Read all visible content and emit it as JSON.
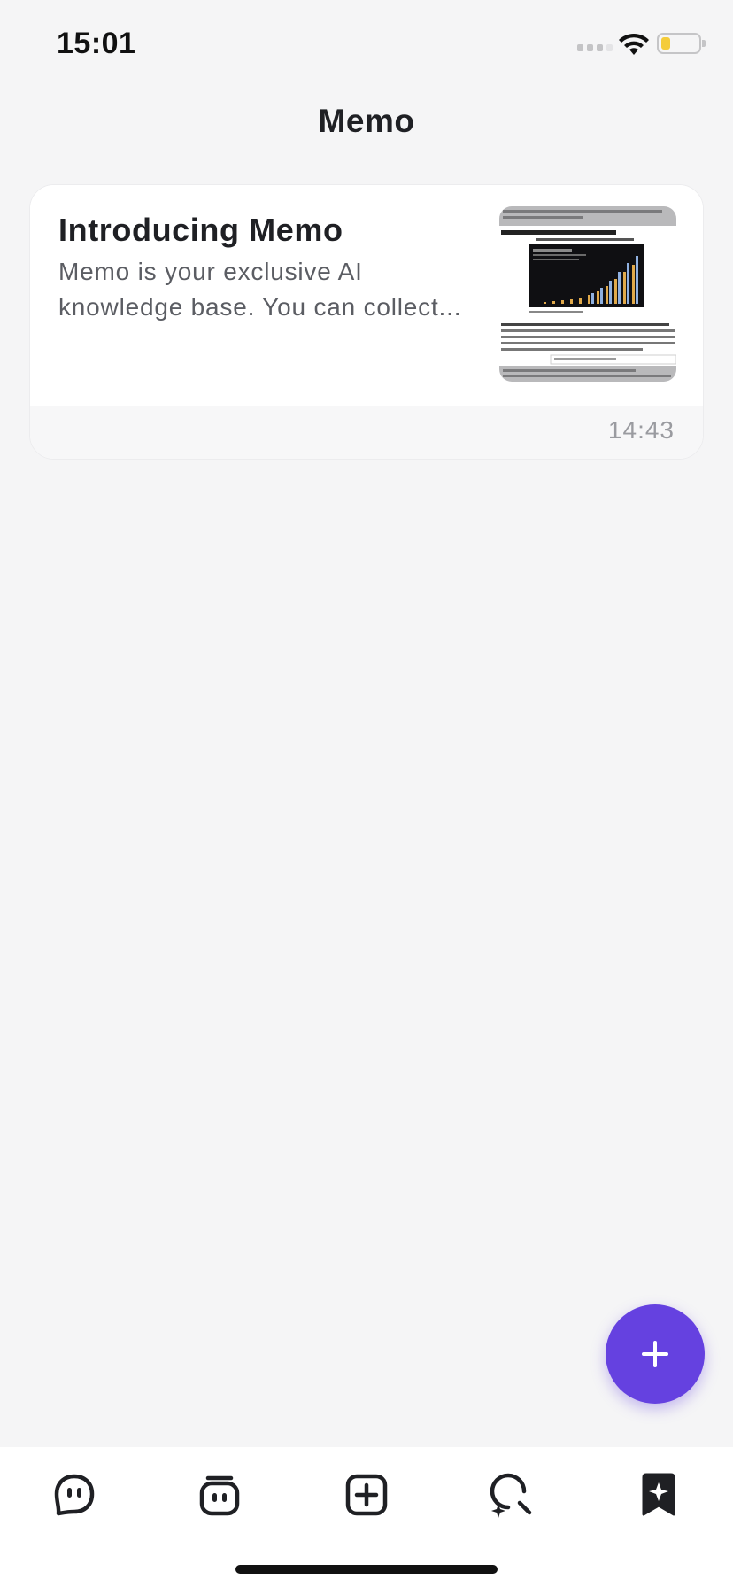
{
  "status_bar": {
    "time": "15:01",
    "icons": [
      "signal-icon",
      "wifi-icon",
      "battery-icon"
    ],
    "battery_color": "#f4cc3a"
  },
  "header": {
    "title": "Memo"
  },
  "memos": [
    {
      "title": "Introducing Memo",
      "snippet": "Memo is your exclusive AI knowledge base. You can collect...",
      "time": "14:43",
      "thumbnail": {
        "heading": "Generative AI Life Sciences, Education Spending",
        "chart_subtitle": "Generative AI Life Sciences, Education Spending",
        "author_line": "Anurag Rana Sr. Technology Analyst, Mandeep Singh, Senior Technology Analyst at Bloomberg Intelligence and lead au"
      }
    }
  ],
  "fab": {
    "icon": "plus-icon",
    "color": "#6541e0"
  },
  "tab_bar": {
    "tabs": [
      {
        "name": "chat",
        "icon": "chat-bot-face-icon",
        "active": false
      },
      {
        "name": "bots",
        "icon": "bot-icon",
        "active": false
      },
      {
        "name": "create",
        "icon": "plus-square-icon",
        "active": false
      },
      {
        "name": "discover",
        "icon": "discover-search-icon",
        "active": false
      },
      {
        "name": "memo",
        "icon": "bookmark-star-icon",
        "active": true
      }
    ]
  }
}
